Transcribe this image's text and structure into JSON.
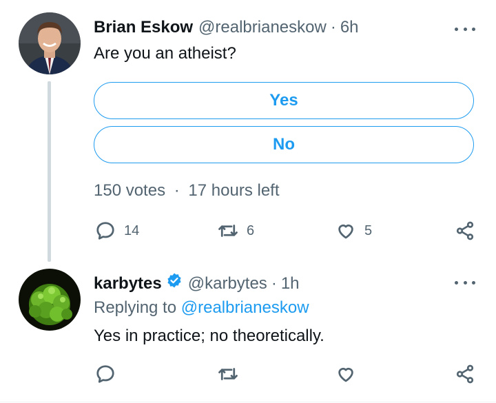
{
  "tweet1": {
    "name": "Brian Eskow",
    "handle": "@realbrianeskow",
    "dot": "·",
    "time": "6h",
    "text": "Are you an atheist?",
    "poll": {
      "options": [
        "Yes",
        "No"
      ],
      "votes": "150 votes",
      "sep": "·",
      "time_left": "17 hours left"
    },
    "actions": {
      "replies": "14",
      "reposts": "6",
      "likes": "5"
    }
  },
  "tweet2": {
    "name": "karbytes",
    "handle": "@karbytes",
    "dot": "·",
    "time": "1h",
    "replying_prefix": "Replying to",
    "replying_mention": "@realbrianeskow",
    "text": "Yes in practice; no theoretically.",
    "actions": {
      "replies": "",
      "reposts": "",
      "likes": ""
    }
  },
  "colors": {
    "accent": "#1d9bf0",
    "muted": "#536471",
    "text": "#0f1419"
  },
  "icons": [
    "reply-icon",
    "repost-icon",
    "like-icon",
    "share-icon",
    "more-icon",
    "verified-badge-icon"
  ]
}
